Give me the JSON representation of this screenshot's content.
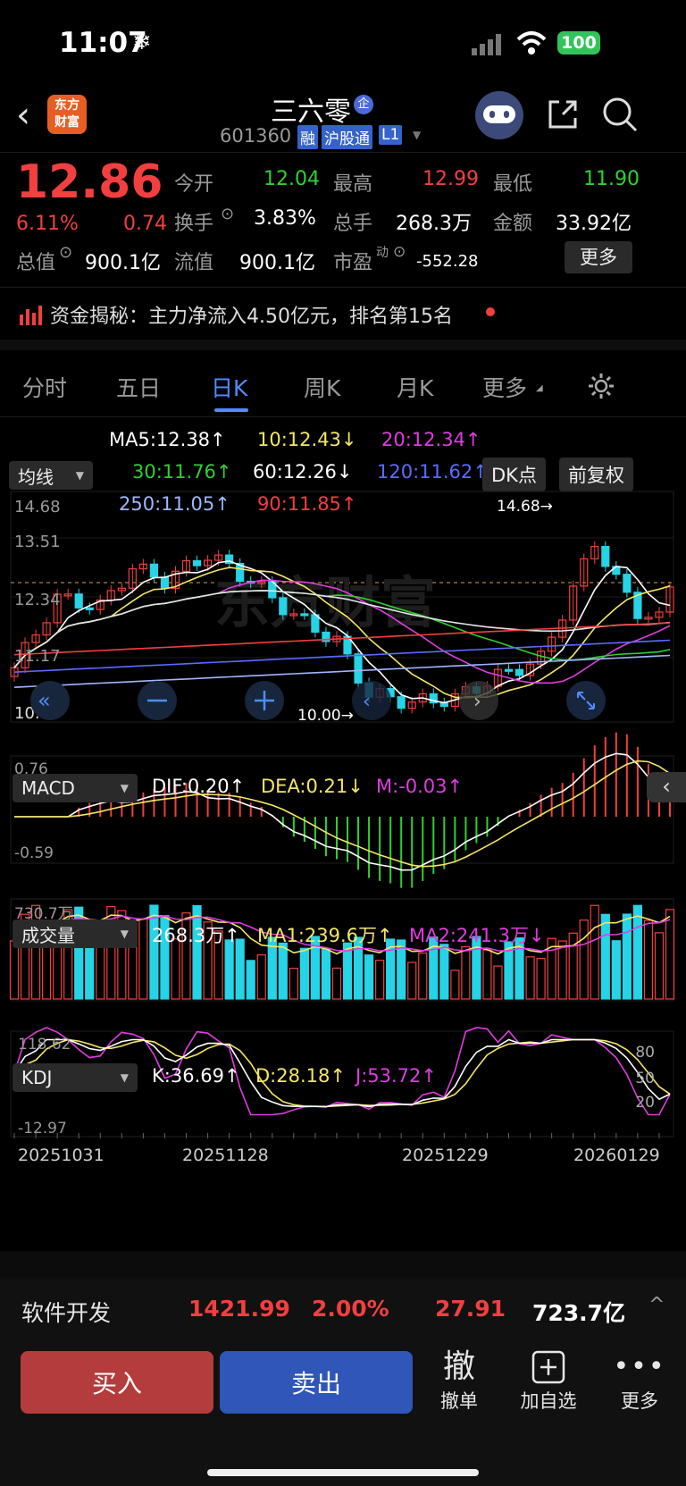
{
  "status": {
    "time": "11:07",
    "snow": "❄",
    "battery": "100"
  },
  "header": {
    "title": "三六零",
    "title_badge": "企",
    "code": "601360",
    "tags": [
      "融",
      "沪股通",
      "L1"
    ],
    "logo_line1": "东方",
    "logo_line2": "财富"
  },
  "quote": {
    "price": "12.86",
    "change_pct": "6.11%",
    "change": "0.74",
    "open_label": "今开",
    "open": "12.04",
    "high_label": "最高",
    "high": "12.99",
    "low_label": "最低",
    "low": "11.90",
    "turnover_label": "换手",
    "turnover": "3.83%",
    "vol_label": "总手",
    "vol": "268.3万",
    "amount_label": "金额",
    "amount": "33.92亿",
    "mktcap_label": "总值",
    "mktcap": "900.1亿",
    "float_label": "流值",
    "float": "900.1亿",
    "pe_label": "市盈",
    "pe_sup": "动",
    "pe": "-552.28",
    "more": "更多"
  },
  "capital": {
    "text": "资金揭秘：主力净流入4.50亿元，排名第15名"
  },
  "tabs": [
    "分时",
    "五日",
    "日K",
    "周K",
    "月K",
    "更多"
  ],
  "ma": {
    "selector": "均线",
    "ma5": "MA5:12.38↑",
    "ma10": "10:12.43↓",
    "ma20": "20:12.34↑",
    "ma30": "30:11.76↑",
    "ma60": "60:12.26↓",
    "ma120": "120:11.62↑",
    "ma250": "250:11.05↑",
    "ma90": "90:11.85↑",
    "dk": "DK点",
    "fq": "前复权"
  },
  "kline": {
    "y_labels": [
      "14.68",
      "13.51",
      "12.34",
      "11.17",
      "10.00"
    ],
    "hi_marker": "14.68→",
    "lo_marker": "10.00→",
    "watermark": "东方财富"
  },
  "macd": {
    "selector": "MACD",
    "dif": "DIF:0.20↑",
    "dea": "DEA:0.21↓",
    "m": "M:-0.03↑",
    "top": "0.76",
    "bottom": "-0.59"
  },
  "volume": {
    "selector": "成交量",
    "val": "268.3万↑",
    "ma1": "MA1:239.6万↑",
    "ma2": "MA2:241.3万↓",
    "top": "730.7万"
  },
  "kdj": {
    "selector": "KDJ",
    "k": "K:36.69↑",
    "d": "D:28.18↑",
    "j": "J:53.72↑",
    "top": "118.62",
    "bottom": "-12.97",
    "r80": "80",
    "r50": "50",
    "r20": "20"
  },
  "dates": [
    "20251031",
    "20251128",
    "20251229",
    "20260129"
  ],
  "ticker": {
    "name": "软件开发",
    "price": "1421.99",
    "pct": "2.00%",
    "chg": "27.91",
    "amount": "723.7亿"
  },
  "actions": {
    "buy": "买入",
    "sell": "卖出",
    "cancel_icon": "撤",
    "cancel": "撤单",
    "add": "加自选",
    "more": "更多"
  },
  "colors": {
    "up": "#f23f3f",
    "down": "#2fd12f",
    "bg": "#000000",
    "cyan": "#27d3e6"
  }
}
